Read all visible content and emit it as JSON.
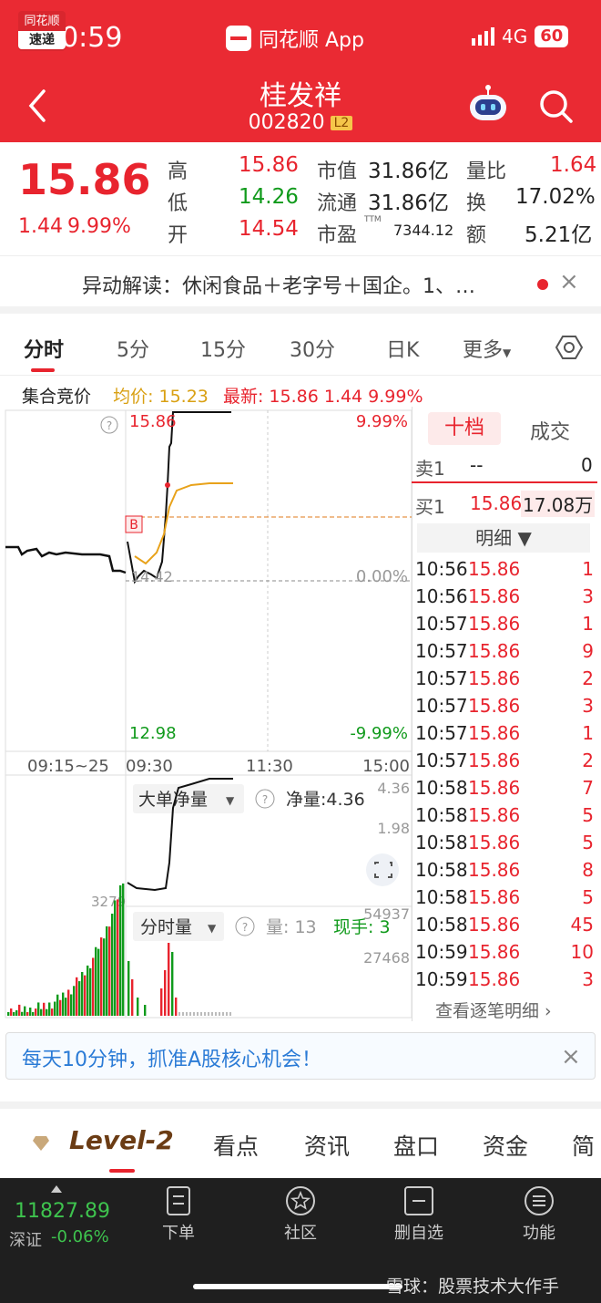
{
  "status": {
    "time": "10:59",
    "app": "同花顺 App",
    "network": "4G",
    "battery": "60"
  },
  "header": {
    "title": "桂发祥",
    "code": "002820",
    "badge": "L2"
  },
  "quote": {
    "price": "15.86",
    "change": "1.44",
    "change_pct": "9.99%",
    "high_label": "高",
    "high": "15.86",
    "low_label": "低",
    "low": "14.26",
    "open_label": "开",
    "open": "14.54",
    "mcap_label": "市值",
    "mcap": "31.86亿",
    "float_label": "流通",
    "float": "31.86亿",
    "pe_label": "市盈",
    "pe_sup": "TTM",
    "pe": "7344.12",
    "vr_label": "量比",
    "vr": "1.64",
    "turn_label": "换",
    "turn": "17.02%",
    "amt_label": "额",
    "amt": "5.21亿"
  },
  "news": {
    "logo_top": "同花顺",
    "logo_bottom": "速递",
    "text": "异动解读：休闲食品＋老字号＋国企。1、…",
    "close": "×"
  },
  "tabs": [
    "分时",
    "5分",
    "15分",
    "30分",
    "日K",
    "更多"
  ],
  "infoline": {
    "auction": "集合竞价",
    "avg": "均价: 15.23",
    "latest": "最新: 15.86  1.44  9.99%"
  },
  "chart": {
    "top_price": "15.86",
    "top_pct": "9.99%",
    "zero_pct": "0.00%",
    "pre_label": "14.42",
    "bottom_price": "12.98",
    "bottom_pct": "-9.99%",
    "b_marker": "B",
    "help": "?",
    "times": [
      "09:15~25",
      "09:30",
      "11:30",
      "15:00"
    ],
    "bigorder_label": "大单净量",
    "net_label": "净量:4.36",
    "sub_top": "4.36",
    "sub_mid": "1.98",
    "vol_label": "分时量",
    "vol_text": "量: 13",
    "now_label": "现手: 3",
    "vol_max": "54937",
    "vol_mid": "27468",
    "vol_left": "3279"
  },
  "book": {
    "tab_active": "十档",
    "tab_other": "成交",
    "sell_label": "卖1",
    "sell_price": "--",
    "sell_vol": "0",
    "buy_label": "买1",
    "buy_price": "15.86",
    "buy_vol": "17.08万",
    "detail": "明细 ▼",
    "trades": [
      [
        "10:56",
        "15.86",
        "1"
      ],
      [
        "10:56",
        "15.86",
        "3"
      ],
      [
        "10:57",
        "15.86",
        "1"
      ],
      [
        "10:57",
        "15.86",
        "9"
      ],
      [
        "10:57",
        "15.86",
        "2"
      ],
      [
        "10:57",
        "15.86",
        "3"
      ],
      [
        "10:57",
        "15.86",
        "1"
      ],
      [
        "10:57",
        "15.86",
        "2"
      ],
      [
        "10:58",
        "15.86",
        "7"
      ],
      [
        "10:58",
        "15.86",
        "5"
      ],
      [
        "10:58",
        "15.86",
        "5"
      ],
      [
        "10:58",
        "15.86",
        "8"
      ],
      [
        "10:58",
        "15.86",
        "5"
      ],
      [
        "10:58",
        "15.86",
        "45"
      ],
      [
        "10:59",
        "15.86",
        "10"
      ],
      [
        "10:59",
        "15.86",
        "3"
      ]
    ],
    "more": "查看逐笔明细 ›"
  },
  "promo": {
    "text": "每天10分钟，抓准A股核心机会！",
    "close": "×"
  },
  "bottom_tabs": {
    "level2": "Level-2",
    "items": [
      "看点",
      "资讯",
      "盘口",
      "资金",
      "简"
    ]
  },
  "nav": {
    "index_value": "11827.89",
    "index_name": "深证",
    "index_change": "-0.06%",
    "items": [
      "下单",
      "社区",
      "删自选",
      "功能"
    ]
  },
  "watermark": "雪球：股票技术大作手"
}
